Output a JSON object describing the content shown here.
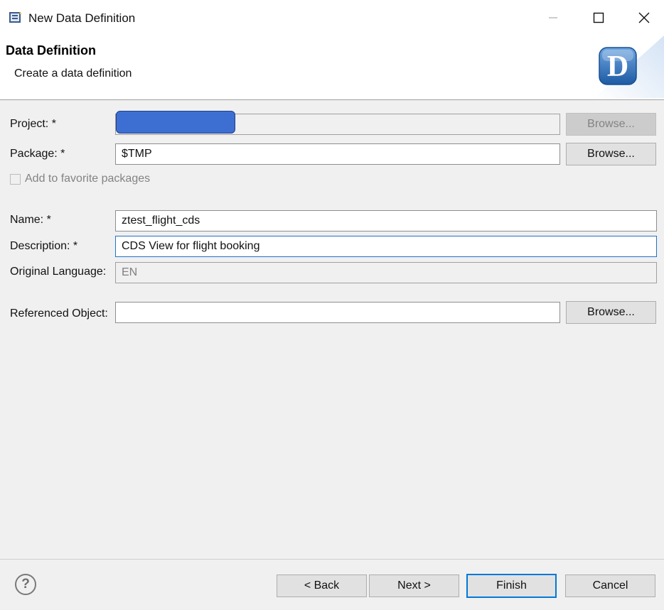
{
  "window": {
    "title": "New Data Definition"
  },
  "header": {
    "title": "Data Definition",
    "subtitle": "Create a data definition",
    "logo_letter": "D"
  },
  "form": {
    "project": {
      "label": "Project: *",
      "browse": "Browse..."
    },
    "package": {
      "label": "Package: *",
      "value": "$TMP",
      "browse": "Browse..."
    },
    "favorite": {
      "label": "Add to favorite packages",
      "checked": false
    },
    "name": {
      "label": "Name: *",
      "value": "ztest_flight_cds"
    },
    "description": {
      "label": "Description: *",
      "value": "CDS View for flight booking"
    },
    "language": {
      "label": "Original Language:",
      "value": "EN"
    },
    "referenced": {
      "label": "Referenced Object:",
      "value": "",
      "browse": "Browse..."
    }
  },
  "footer": {
    "help": "?",
    "back": "< Back",
    "next": "Next >",
    "finish": "Finish",
    "cancel": "Cancel"
  },
  "colors": {
    "accent": "#0078d7",
    "project_chip": "#3d6fd3"
  }
}
